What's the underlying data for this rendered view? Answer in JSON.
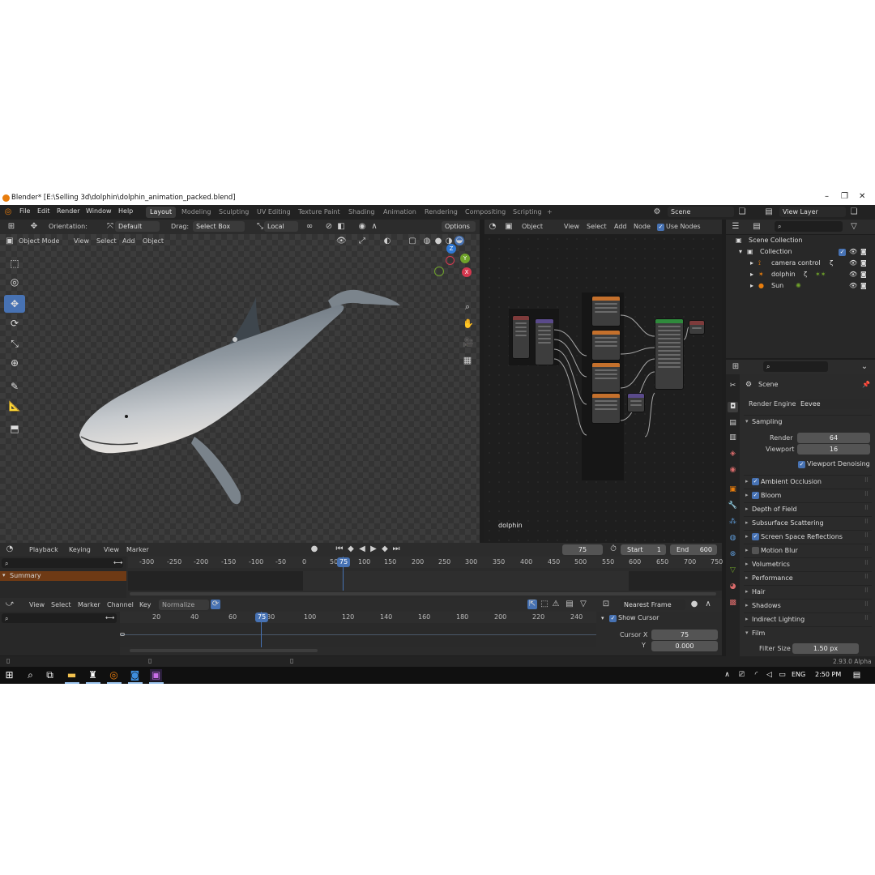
{
  "window": {
    "title": "Blender* [E:\\Selling 3d\\dolphin\\dolphin_animation_packed.blend]",
    "minimize": "–",
    "maximize": "❐",
    "close": "✕"
  },
  "menu": {
    "items": [
      "File",
      "Edit",
      "Render",
      "Window",
      "Help"
    ],
    "workspaces": [
      "Layout",
      "Modeling",
      "Sculpting",
      "UV Editing",
      "Texture Paint",
      "Shading",
      "Animation",
      "Rendering",
      "Compositing",
      "Scripting"
    ],
    "add_tab": "+",
    "scene": "Scene",
    "view_layer": "View Layer"
  },
  "viewport_header": {
    "orientation_label": "Orientation:",
    "orientation_value": "Default",
    "drag_label": "Drag:",
    "drag_value": "Select Box",
    "pivot": "Local",
    "options": "Options",
    "mode": "Object Mode",
    "menus": [
      "View",
      "Select",
      "Add",
      "Object"
    ]
  },
  "gizmo": {
    "x": "X",
    "y": "Y",
    "z": "Z"
  },
  "node_editor": {
    "type": "Object",
    "menus": [
      "View",
      "Select",
      "Add",
      "Node"
    ],
    "use_nodes_label": "Use Nodes",
    "object_name": "dolphin"
  },
  "outliner": {
    "root": "Scene Collection",
    "collection": "Collection",
    "objects": [
      "camera control",
      "dolphin",
      "Sun"
    ]
  },
  "properties": {
    "scene_name": "Scene",
    "render_engine_label": "Render Engine",
    "render_engine_value": "Eevee",
    "sampling_label": "Sampling",
    "render_label": "Render",
    "render_value": "64",
    "viewport_label": "Viewport",
    "viewport_value": "16",
    "viewport_denoising": "Viewport Denoising",
    "sections": [
      {
        "label": "Ambient Occlusion",
        "checkbox": true,
        "checked": true
      },
      {
        "label": "Bloom",
        "checkbox": true,
        "checked": true
      },
      {
        "label": "Depth of Field",
        "checkbox": false,
        "checked": false
      },
      {
        "label": "Subsurface Scattering",
        "checkbox": false,
        "checked": false
      },
      {
        "label": "Screen Space Reflections",
        "checkbox": true,
        "checked": true
      },
      {
        "label": "Motion Blur",
        "checkbox": true,
        "checked": false
      },
      {
        "label": "Volumetrics",
        "checkbox": false,
        "checked": false
      },
      {
        "label": "Performance",
        "checkbox": false,
        "checked": false
      },
      {
        "label": "Hair",
        "checkbox": false,
        "checked": false
      },
      {
        "label": "Shadows",
        "checkbox": false,
        "checked": false
      },
      {
        "label": "Indirect Lighting",
        "checkbox": false,
        "checked": false
      }
    ],
    "film_label": "Film",
    "filter_size_label": "Filter Size",
    "filter_size_value": "1.50 px"
  },
  "timeline": {
    "menus": [
      "Playback",
      "Keying",
      "View",
      "Marker"
    ],
    "current_frame": "75",
    "start_label": "Start",
    "start_value": "1",
    "end_label": "End",
    "end_value": "600",
    "ruler": [
      "-300",
      "-250",
      "-200",
      "-150",
      "-100",
      "-50",
      "0",
      "50",
      "100",
      "150",
      "200",
      "250",
      "300",
      "350",
      "400",
      "450",
      "500",
      "550",
      "600",
      "650",
      "700",
      "750"
    ],
    "cursor": "75",
    "summary": "Summary"
  },
  "graph_editor": {
    "menus": [
      "View",
      "Select",
      "Marker",
      "Channel",
      "Key"
    ],
    "normalize": "Normalize",
    "snap": "Nearest Frame",
    "ruler": [
      "20",
      "40",
      "60",
      "80",
      "100",
      "120",
      "140",
      "160",
      "180",
      "200",
      "220",
      "240"
    ],
    "cursor": "75",
    "show_cursor_label": "Show Cursor",
    "cursor_x_label": "Cursor X",
    "cursor_x_value": "75",
    "cursor_y_label": "Y",
    "cursor_y_value": "0.000"
  },
  "status": {
    "version": "2.93.0 Alpha"
  },
  "taskbar": {
    "language": "ENG",
    "time": "2:50 PM"
  },
  "colors": {
    "accent": "#4772b3",
    "orange": "#e87d0d",
    "bg": "#1d1d1d"
  }
}
